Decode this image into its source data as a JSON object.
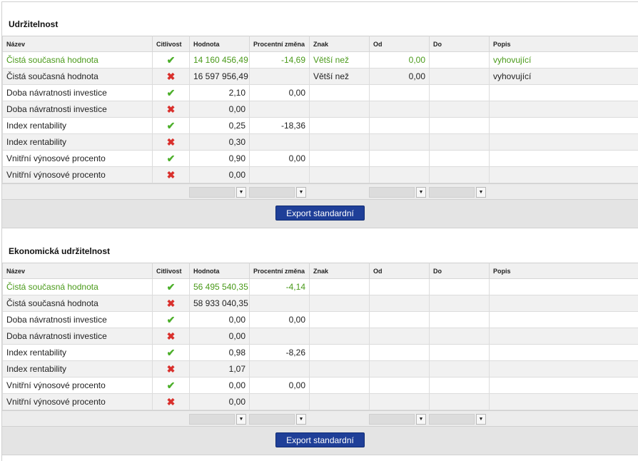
{
  "columns": [
    "Název",
    "Citlivost",
    "Hodnota",
    "Procentní změna",
    "Znak",
    "Od",
    "Do",
    "Popis"
  ],
  "sections": [
    {
      "title": "Udržitelnost",
      "rows": [
        {
          "name": "Čistá současná hodnota",
          "sensitivity": "check-icon",
          "value": "14 160 456,49",
          "pct": "-14,69",
          "sign": "Větší než",
          "from": "0,00",
          "to": "",
          "desc": "vyhovující",
          "highlight": true
        },
        {
          "name": "Čistá současná hodnota",
          "sensitivity": "cross-icon",
          "value": "16 597 956,49",
          "pct": "",
          "sign": "Větší než",
          "from": "0,00",
          "to": "",
          "desc": "vyhovující",
          "highlight": false
        },
        {
          "name": "Doba návratnosti investice",
          "sensitivity": "check-icon",
          "value": "2,10",
          "pct": "0,00",
          "sign": "",
          "from": "",
          "to": "",
          "desc": "",
          "highlight": false
        },
        {
          "name": "Doba návratnosti investice",
          "sensitivity": "cross-icon",
          "value": "0,00",
          "pct": "",
          "sign": "",
          "from": "",
          "to": "",
          "desc": "",
          "highlight": false
        },
        {
          "name": "Index rentability",
          "sensitivity": "check-icon",
          "value": "0,25",
          "pct": "-18,36",
          "sign": "",
          "from": "",
          "to": "",
          "desc": "",
          "highlight": false
        },
        {
          "name": "Index rentability",
          "sensitivity": "cross-icon",
          "value": "0,30",
          "pct": "",
          "sign": "",
          "from": "",
          "to": "",
          "desc": "",
          "highlight": false
        },
        {
          "name": "Vnitřní výnosové procento",
          "sensitivity": "check-icon",
          "value": "0,90",
          "pct": "0,00",
          "sign": "",
          "from": "",
          "to": "",
          "desc": "",
          "highlight": false
        },
        {
          "name": "Vnitřní výnosové procento",
          "sensitivity": "cross-icon",
          "value": "0,00",
          "pct": "",
          "sign": "",
          "from": "",
          "to": "",
          "desc": "",
          "highlight": false
        }
      ],
      "export_label": "Export standardní"
    },
    {
      "title": "Ekonomická udržitelnost",
      "rows": [
        {
          "name": "Čistá současná hodnota",
          "sensitivity": "check-icon",
          "value": "56 495 540,35",
          "pct": "-4,14",
          "sign": "",
          "from": "",
          "to": "",
          "desc": "",
          "highlight": true
        },
        {
          "name": "Čistá současná hodnota",
          "sensitivity": "cross-icon",
          "value": "58 933 040,35",
          "pct": "",
          "sign": "",
          "from": "",
          "to": "",
          "desc": "",
          "highlight": false
        },
        {
          "name": "Doba návratnosti investice",
          "sensitivity": "check-icon",
          "value": "0,00",
          "pct": "0,00",
          "sign": "",
          "from": "",
          "to": "",
          "desc": "",
          "highlight": false
        },
        {
          "name": "Doba návratnosti investice",
          "sensitivity": "cross-icon",
          "value": "0,00",
          "pct": "",
          "sign": "",
          "from": "",
          "to": "",
          "desc": "",
          "highlight": false
        },
        {
          "name": "Index rentability",
          "sensitivity": "check-icon",
          "value": "0,98",
          "pct": "-8,26",
          "sign": "",
          "from": "",
          "to": "",
          "desc": "",
          "highlight": false
        },
        {
          "name": "Index rentability",
          "sensitivity": "cross-icon",
          "value": "1,07",
          "pct": "",
          "sign": "",
          "from": "",
          "to": "",
          "desc": "",
          "highlight": false
        },
        {
          "name": "Vnitřní výnosové procento",
          "sensitivity": "check-icon",
          "value": "0,00",
          "pct": "0,00",
          "sign": "",
          "from": "",
          "to": "",
          "desc": "",
          "highlight": false
        },
        {
          "name": "Vnitřní výnosové procento",
          "sensitivity": "cross-icon",
          "value": "0,00",
          "pct": "",
          "sign": "",
          "from": "",
          "to": "",
          "desc": "",
          "highlight": false
        }
      ],
      "export_label": "Export standardní"
    }
  ],
  "icons": {
    "check": "✔",
    "cross": "✖",
    "dropdown": "▼"
  },
  "colors": {
    "ok_text": "#4a9a1a",
    "check": "#4caf2a",
    "cross": "#d9302c",
    "export_button": "#1f3f98"
  }
}
